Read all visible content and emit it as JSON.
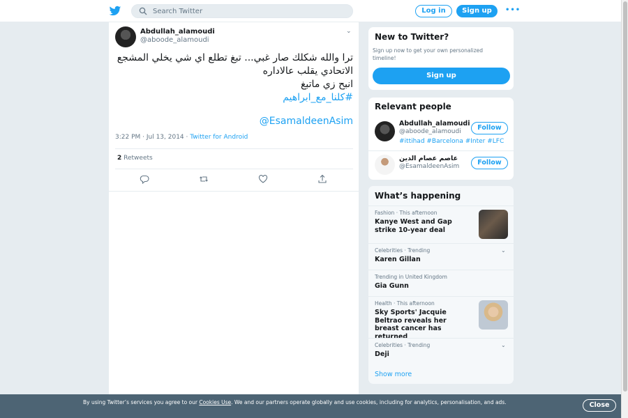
{
  "header": {
    "search_placeholder": "Search Twitter",
    "login_label": "Log in",
    "signup_label": "Sign up",
    "more_label": "•••"
  },
  "tweet": {
    "author_name": "Abdullah_alamoudi",
    "author_handle": "@aboode_alamoudi",
    "text_line1": "ترا والله شكلك صار غبي... تبغ تطلع اي شي يخلي المشجع",
    "text_line2": "الاتحادي يقلب عالاداره",
    "text_line3": "انبح زي ماتبغ",
    "hashtag": "#كلنا_مع_ابراهيم",
    "mention": "@EsamaldeenAsim",
    "time": "3:22 PM · Jul 13, 2014 · ",
    "source": "Twitter for Android",
    "retweet_count": "2",
    "retweet_label": " Retweets"
  },
  "new_to_twitter": {
    "title": "New to Twitter?",
    "subtitle": "Sign up now to get your own personalized timeline!",
    "button": "Sign up"
  },
  "relevant_people": {
    "title": "Relevant people",
    "people": [
      {
        "name": "Abdullah_alamoudi",
        "handle": "@aboode_alamoudi",
        "bio": "#ittihad #Barcelona #Inter #LFC",
        "follow": "Follow"
      },
      {
        "name": "عاصم عصام الدين",
        "handle": "@EsamaldeenAsim",
        "bio": "",
        "follow": "Follow"
      }
    ]
  },
  "whats_happening": {
    "title": "What’s happening",
    "trends": [
      {
        "meta": "Fashion · This afternoon",
        "title": "Kanye West and Gap strike 10-year deal"
      },
      {
        "meta": "Celebrities · Trending",
        "title": "Karen Gillan"
      },
      {
        "meta": "Trending in United Kingdom",
        "title": "Gia Gunn"
      },
      {
        "meta": "Health · This afternoon",
        "title": "Sky Sports' Jacquie Beltrao reveals her breast cancer has returned"
      },
      {
        "meta": "Celebrities · Trending",
        "title": "Deji"
      }
    ],
    "show_more": "Show more"
  },
  "cookie_bar": {
    "text_before": "By using Twitter’s services you agree to our ",
    "link": "Cookies Use",
    "text_after": ". We and our partners operate globally and use cookies, including for analytics, personalisation, and ads.",
    "close": "Close"
  },
  "colors": {
    "accent": "#1da1f2",
    "cookie_bg": "#4d6474",
    "page_bg": "#e6ecf0"
  }
}
